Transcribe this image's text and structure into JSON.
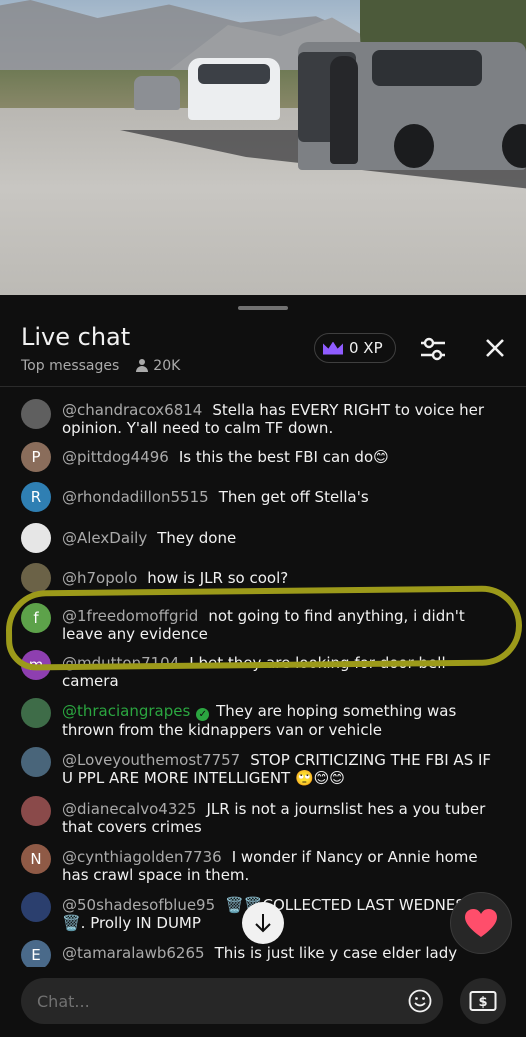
{
  "header": {
    "title": "Live chat",
    "mode": "Top messages",
    "viewers": "20K",
    "xp_label": "0 XP"
  },
  "icons": {
    "crown": "crown-icon",
    "filter": "sliders-icon",
    "close": "close-icon",
    "emoji": "emoji-icon",
    "superchat": "dollar-icon",
    "heart": "heart-icon",
    "scroll": "arrow-down-icon"
  },
  "colors": {
    "background": "#0f0f0f",
    "author": "#aaaaaa",
    "member_author": "#2ba640",
    "crown": "#8f5cff",
    "heart": "#ff4e6b",
    "highlight": "#9c9a1a"
  },
  "messages": [
    {
      "author": "@chandracox6814",
      "text": "Stella has EVERY RIGHT to voice her opinion. Y'all need to calm TF down.",
      "avatar_letter": "",
      "avatar_color": "#5f5f5f"
    },
    {
      "author": "@pittdog4496",
      "text": "Is this the best FBI can do😊",
      "avatar_letter": "P",
      "avatar_color": "#8a6d5b"
    },
    {
      "author": "@rhondadillon5515",
      "text": "Then get off Stella's",
      "avatar_letter": "R",
      "avatar_color": "#2f7fb3"
    },
    {
      "author": "@AlexDaily",
      "text": "They done",
      "avatar_letter": "",
      "avatar_color": "#e6e6e6"
    },
    {
      "author": "@h7opolo",
      "text": "how is JLR so cool?",
      "avatar_letter": "",
      "avatar_color": "#6b6247"
    },
    {
      "author": "@1freedomoffgrid",
      "text": "not going to find anything, i didn't leave any evidence",
      "avatar_letter": "f",
      "avatar_color": "#5da24a"
    },
    {
      "author": "@mdutton7104",
      "text": "I bet they are looking for door bell camera",
      "avatar_letter": "m",
      "avatar_color": "#8e3fb0"
    },
    {
      "author": "@thraciangrapes",
      "text": "They are hoping something was thrown from the kidnappers van or vehicle",
      "avatar_letter": "",
      "avatar_color": "#3e6c48",
      "member": true
    },
    {
      "author": "@Loveyouthemost7757",
      "text": "STOP CRITICIZING THE FBI AS IF U PPL ARE MORE INTELLIGENT 🙄😊😊",
      "avatar_letter": "",
      "avatar_color": "#49657a"
    },
    {
      "author": "@dianecalvo4325",
      "text": "JLR is not a journslist hes a you tuber that covers crimes",
      "avatar_letter": "",
      "avatar_color": "#8a4a4a"
    },
    {
      "author": "@cynthiagolden7736",
      "text": "I wonder if Nancy or Annie home has crawl space in them.",
      "avatar_letter": "N",
      "avatar_color": "#8f5a46"
    },
    {
      "author": "@50shadesofblue95",
      "text": "🗑️🗑️COLLECTED LAST WEDNESDAY🗑️. Prolly IN DUMP",
      "avatar_letter": "",
      "avatar_color": "#2b3f6e"
    },
    {
      "author": "@tamaralawb6265",
      "text": "This is just like y case elder lady",
      "avatar_letter": "E",
      "avatar_color": "#4a6a8a"
    }
  ],
  "input": {
    "placeholder": "Chat..."
  }
}
